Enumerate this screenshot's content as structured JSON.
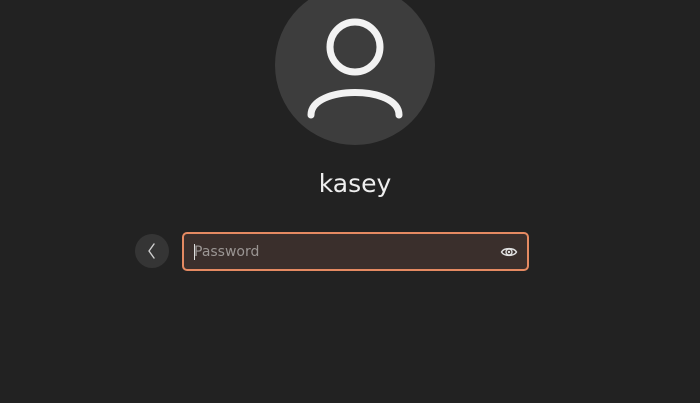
{
  "user": {
    "name": "kasey",
    "avatar_icon": "user-silhouette-icon"
  },
  "login": {
    "password_placeholder": "Password",
    "password_value": "",
    "back_icon": "chevron-left-icon",
    "reveal_icon": "eye-icon"
  },
  "colors": {
    "background": "#222222",
    "avatar_bg": "#3d3d3d",
    "accent_border": "#e58a62"
  }
}
